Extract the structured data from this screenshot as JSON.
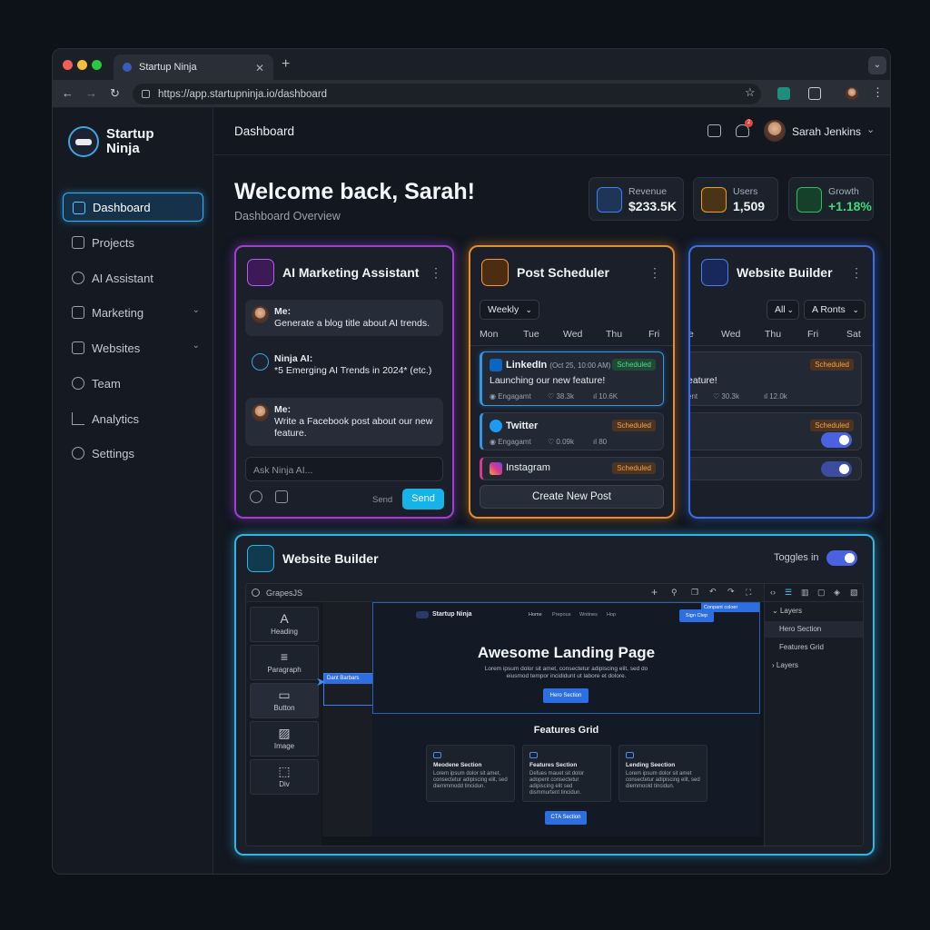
{
  "browser": {
    "tab_title": "Startup Ninja",
    "url": "https://app.startupninja.io/dashboard"
  },
  "sidebar": {
    "logo_line1": "Startup",
    "logo_line2": "Ninja",
    "items": [
      {
        "label": "Dashboard",
        "icon": "grid-icon",
        "active": true
      },
      {
        "label": "Projects",
        "icon": "folder-icon"
      },
      {
        "label": "AI Assistant",
        "icon": "bulb-icon"
      },
      {
        "label": "Marketing",
        "icon": "megaphone-icon",
        "expandable": true
      },
      {
        "label": "Websites",
        "icon": "browser-icon",
        "expandable": true
      },
      {
        "label": "Team",
        "icon": "people-icon"
      },
      {
        "label": "Analytics",
        "icon": "bar-chart-icon"
      },
      {
        "label": "Settings",
        "icon": "gear-icon"
      }
    ]
  },
  "header": {
    "title": "Dashboard",
    "notification_count": "2",
    "user_name": "Sarah Jenkins"
  },
  "welcome": {
    "title": "Welcome back, Sarah!",
    "subtitle": "Dashboard Overview"
  },
  "stats": [
    {
      "label": "Revenue",
      "value": "$233.5K",
      "color": "#3b82f6"
    },
    {
      "label": "Users",
      "value": "1,509",
      "color": "#f59e0b"
    },
    {
      "label": "Growth",
      "value": "+1.18%",
      "color": "#22c55e"
    }
  ],
  "ai_card": {
    "title": "AI Marketing Assistant",
    "messages": [
      {
        "sender": "Me:",
        "text": "Generate a blog title about AI trends."
      },
      {
        "sender": "Ninja AI:",
        "text": "*5 Emerging AI Trends in 2024* (etc.)"
      },
      {
        "sender": "Me:",
        "text": "Write a Facebook post about our new feature."
      }
    ],
    "input_placeholder": "Ask Ninja AI...",
    "send_hint": "Send",
    "send_button": "Send"
  },
  "scheduler": {
    "title": "Post Scheduler",
    "range": "Weekly",
    "days": [
      "Mon",
      "Tue",
      "Wed",
      "Thu",
      "Fri"
    ],
    "posts": [
      {
        "platform": "LinkedIn",
        "time": "(Oct 25, 10:00 AM)",
        "status": "Scheduled",
        "text": "Launching our new feature!",
        "engagement": "Engagamt",
        "likes": "38.3k",
        "views": "10.6K"
      },
      {
        "platform": "Twitter",
        "status": "Scheduled",
        "engagement": "Engagamt",
        "likes": "0.09k",
        "views": "80"
      },
      {
        "platform": "Instagram",
        "status": "Scheduled"
      }
    ],
    "create_button": "Create New Post"
  },
  "website_builder_card": {
    "title": "Website Builder",
    "filter1": "All",
    "filter2": "A Ronts",
    "days": [
      "e",
      "Wed",
      "Thu",
      "Fri",
      "Sat"
    ],
    "rows": [
      {
        "status": "Scheduled",
        "text": "eature!",
        "meta1": "ent",
        "likes": "30.3k",
        "views": "12.0k"
      },
      {
        "status": "Scheduled"
      }
    ]
  },
  "builder_panel": {
    "title": "Website Builder",
    "toggle_label": "Toggles in",
    "editor_name": "GrapesJS",
    "blocks": [
      {
        "icon": "A",
        "label": "Heading"
      },
      {
        "icon": "≡",
        "label": "Paragraph"
      },
      {
        "icon": "▭",
        "label": "Button"
      },
      {
        "icon": "▨",
        "label": "Image"
      },
      {
        "icon": "⬚",
        "label": "Div"
      }
    ],
    "selected_tag": "Dant Barbars",
    "canvas": {
      "brand": "Startup Ninja",
      "nav": [
        "Home",
        "Prepous",
        "Wntines",
        "Hop"
      ],
      "cta_tag": "Conpant coloer",
      "sign_btn": "Sign Ctep",
      "hero_title": "Awesome Landing Page",
      "hero_text1": "Lorem ipsum dolor sit amet, consectetur adipiscing elit, sed do",
      "hero_text2": "eiusmod tempor incididunt ut labore et dolore.",
      "hero_btn": "Hero Section",
      "features_title": "Features Grid",
      "features": [
        {
          "title": "Meodene Section",
          "text": "Lorem ipsum dolor sit amet, consectetur adipiscing elit, sed diemmmodd tincidun."
        },
        {
          "title": "Features Section",
          "text": "Defues mauet sit dolor adopent consectetur adipiscing elit sed dismmurtent tincidun."
        },
        {
          "title": "Lending Seection",
          "text": "Lorem ipsum dolor sit amet consectetur adipiscing elit, sed diemmoold tincidun."
        }
      ],
      "cta_btn": "CTA Section"
    },
    "layers": {
      "title": "Layers",
      "items": [
        "Hero Section",
        "Features Grid"
      ],
      "footer": "Layers"
    }
  }
}
